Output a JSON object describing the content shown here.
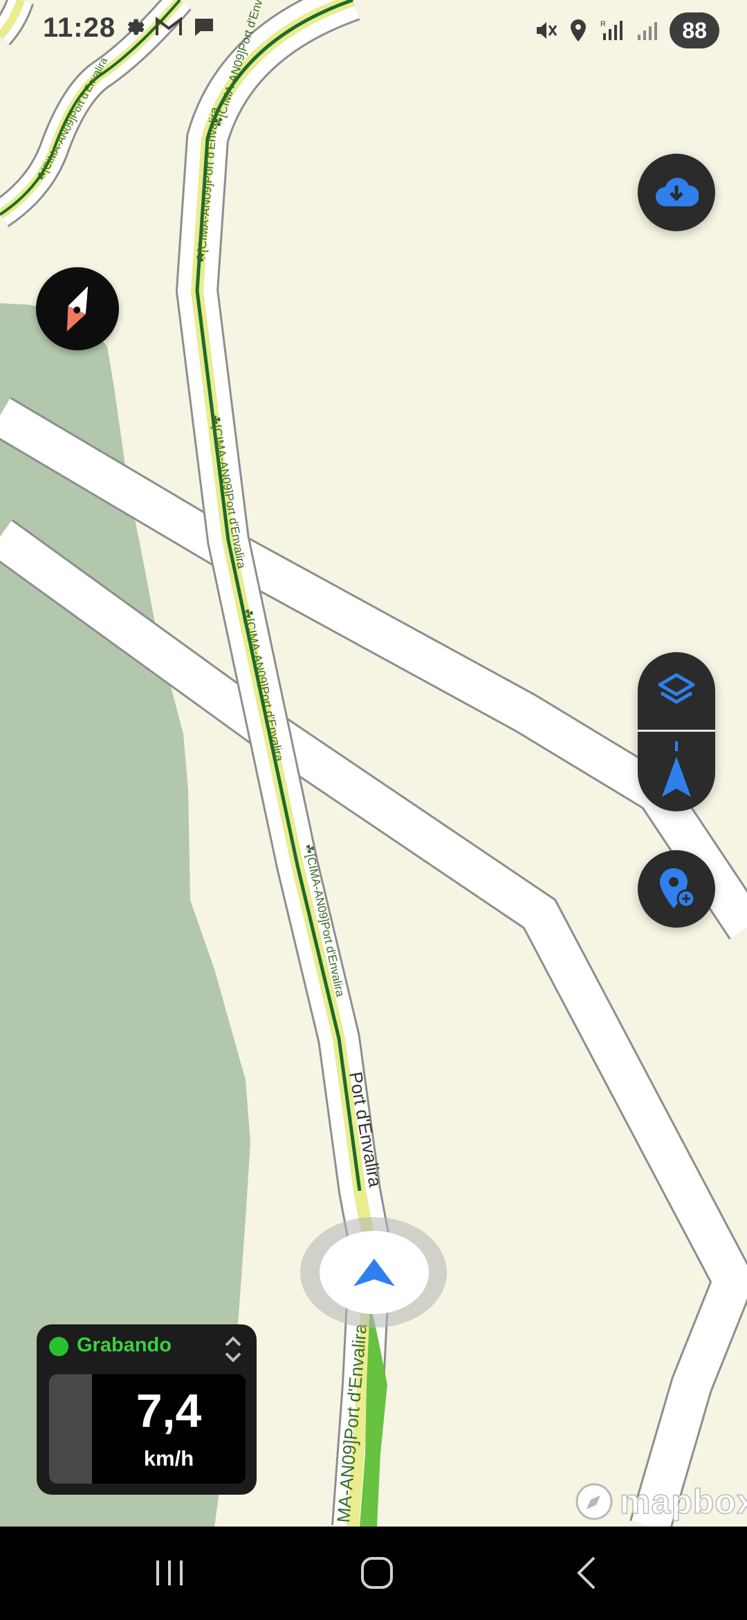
{
  "status_bar": {
    "time": "11:28",
    "left_icons": [
      "settings-icon",
      "gmail-icon",
      "chat-icon"
    ],
    "right_icons": [
      "mute-icon",
      "location-icon",
      "signal-r-icon",
      "signal-icon"
    ],
    "battery": "88"
  },
  "map": {
    "road_labels": {
      "route_label_1": "☘[CIMA-AN09]Port d'Envalira",
      "route_label_2": "☘[CIMA-AN09]Port d'Envalira",
      "route_label_3": "☘[CIMA-AN09]Port d'Envalira",
      "route_label_4": "☘[CIMA-AN09]Port d'Envalira",
      "route_label_5": "☘[CIMA-AN09]Port d'Envalira",
      "route_label_6": "☘[CIMA-AN09]Port d'Envalira",
      "road_name": "Port d'Envalira",
      "route_label_bottom": "MA-AN09]Port d'Envalira"
    },
    "colors": {
      "land": "#f6f4e3",
      "forest": "#b2c7ab",
      "road": "#ffffff",
      "road_edge": "#8e8e8e",
      "route_highlight": "#e9ec8f",
      "route_line": "#1e6b2a",
      "traveled_line": "#66c23f"
    }
  },
  "controls": {
    "download_icon": "cloud-download-icon",
    "layers_icon": "layers-icon",
    "navigation_icon": "navigation-arrow-icon",
    "add_poi_icon": "add-location-icon",
    "compass_icon": "compass-icon",
    "location_icon": "location-arrow-icon",
    "accent_color": "#2f80ed"
  },
  "recording": {
    "status": "Grabando",
    "speed": "7,4",
    "unit": "km/h",
    "status_color": "#29c22e"
  },
  "attribution": {
    "text": "mapbox"
  },
  "nav_bar": {
    "icons": [
      "recents-icon",
      "home-icon",
      "back-icon"
    ]
  }
}
